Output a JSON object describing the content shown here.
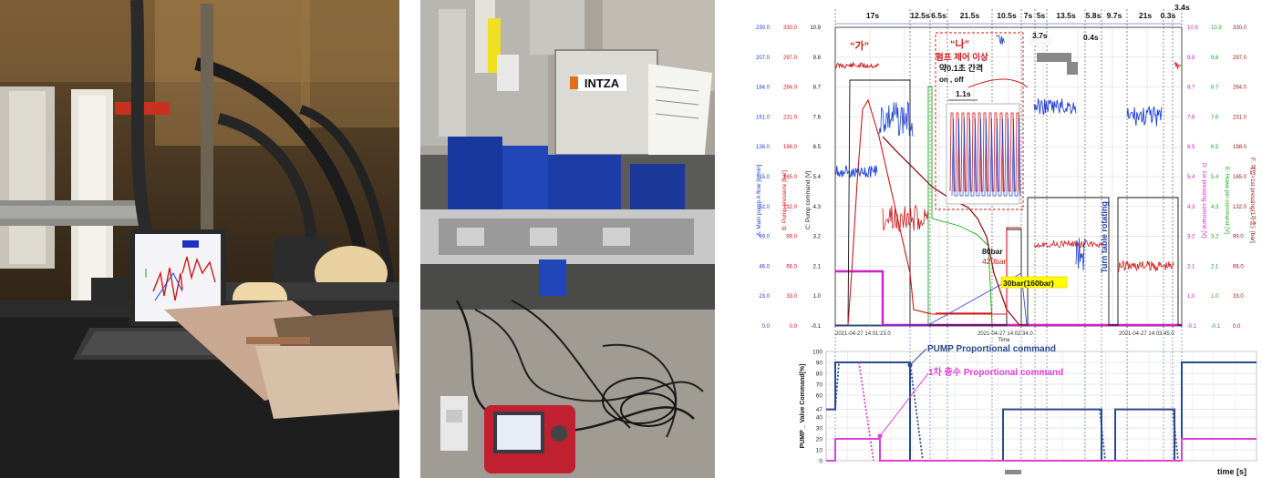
{
  "photos": {
    "mid": {
      "brand": "INTZA"
    }
  },
  "chart_data": [
    {
      "type": "line",
      "x_start": "2021-04-27  14:01:23.0",
      "x_mid": "2021-04-27  14:02:34.0",
      "x_end": "2021-04-27  14:03:45.0",
      "xlabel": "Time",
      "left_axes": [
        {
          "label": "A: Main pump A flow [L/min]",
          "color": "#1f3fd0",
          "ticks": [
            "230.0",
            "207.0",
            "184.0",
            "161.0",
            "138.0",
            "115.0",
            "92.0",
            "69.0",
            "46.0",
            "23.0",
            "0.0"
          ]
        },
        {
          "label": "B: Pump pressure [bar]",
          "color": "#d01818",
          "ticks": [
            "330.0",
            "297.0",
            "264.0",
            "231.0",
            "198.0",
            "165.0",
            "132.0",
            "99.0",
            "66.0",
            "33.0",
            "0.0"
          ]
        },
        {
          "label": "C: Pump command [V]",
          "color": "#111111",
          "ticks": [
            "10.9",
            "9.8",
            "8.7",
            "7.6",
            "6.5",
            "5.4",
            "4.3",
            "3.2",
            "2.1",
            "1.0",
            "-0.1"
          ]
        }
      ],
      "right_axes": [
        {
          "label": "D: 1st pressing command [V]",
          "color": "#d020c8",
          "ticks": [
            "10.9",
            "9.8",
            "8.7",
            "7.6",
            "6.5",
            "5.4",
            "4.3",
            "3.2",
            "2.1",
            "1.0",
            "-0.1"
          ]
        },
        {
          "label": "E: Howe pin command [V]",
          "color": "#18a818",
          "ticks": [
            "10.9",
            "9.8",
            "8.7",
            "7.6",
            "6.5",
            "5.4",
            "4.3",
            "3.2",
            "2.1",
            "1.0",
            "-0.1"
          ]
        },
        {
          "label": "F: 예압>1st pressing(1차충)· [bar]",
          "color": "#901818",
          "ticks": [
            "330.0",
            "297.0",
            "264.0",
            "231.0",
            "198.0",
            "165.0",
            "132.0",
            "99.0",
            "66.0",
            "33.0",
            "0.0"
          ]
        }
      ],
      "durations": [
        "17s",
        "12.5s",
        "6.5s",
        "21.5s",
        "10.5s",
        "7s",
        "5s",
        "13.5s",
        "5.8s",
        "9.7s",
        "21s",
        "0.3s",
        "3.4s"
      ],
      "annotations": {
        "ga": "“가”",
        "na": "“나”",
        "pump_abnormal": "펌프 제어 이상",
        "interval": "약0.1초 간격",
        "onoff": "on , off",
        "inset_period": "1.1s",
        "d37": "3.7s",
        "d04": "0.4s",
        "bar80": "80bar",
        "bar420": "420bar",
        "bar30": "30bar(160bar)",
        "turn": "Turn table rotating"
      }
    },
    {
      "type": "line",
      "ylabel": "PUMP _ Valve Command[%]",
      "xlabel": "time [s]",
      "y_ticks": [
        100,
        90,
        80,
        70,
        60,
        47,
        40,
        30,
        20,
        10,
        0
      ],
      "ylim": [
        0,
        100
      ],
      "series": [
        {
          "name": "PUMP Proportional command",
          "color": "#2a4a8a"
        },
        {
          "name": "1차 충수 Proportional command",
          "color": "#e040d8"
        }
      ]
    }
  ]
}
